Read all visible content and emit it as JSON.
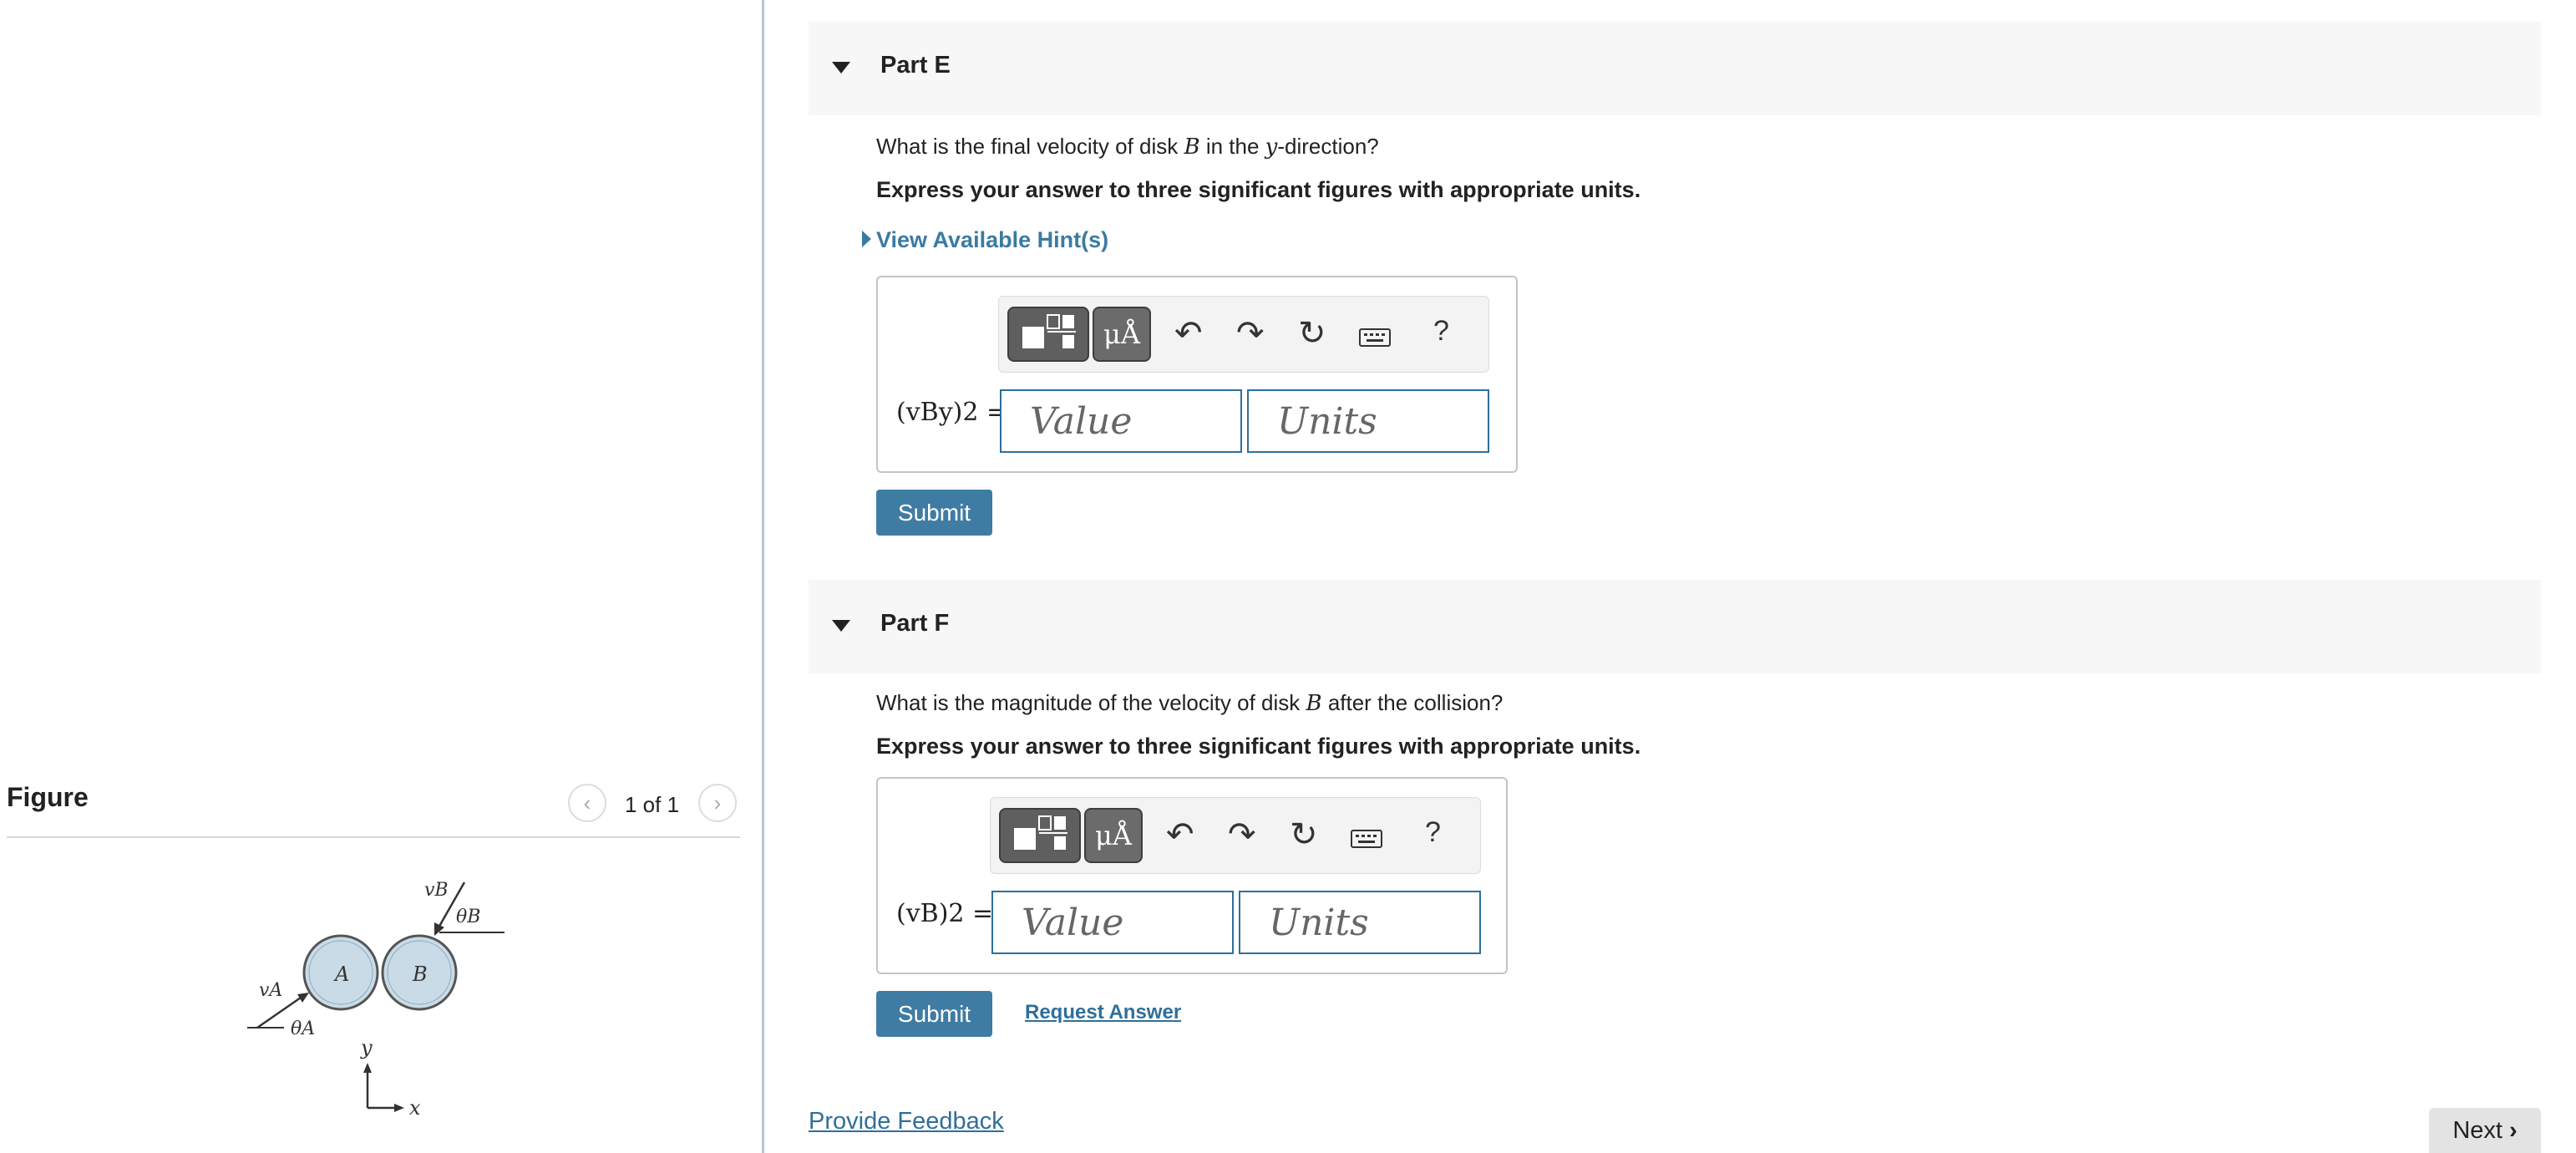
{
  "figure": {
    "title": "Figure",
    "pager": "1 of 1",
    "prev_icon": "chevron-left-icon",
    "next_icon": "chevron-right-icon",
    "labels": {
      "vB": "vB",
      "thetaB": "θB",
      "vA": "vA",
      "thetaA": "θA",
      "diskA": "A",
      "diskB": "B",
      "y": "y",
      "x": "x"
    }
  },
  "partE": {
    "title": "Part E",
    "question_pre": "What is the final velocity of disk ",
    "question_var": "B",
    "question_mid": " in the ",
    "question_var2": "y",
    "question_post": "-direction?",
    "instruction": "Express your answer to three significant figures with appropriate units.",
    "hint": "View Available Hint(s)",
    "eq_label": "(vBy)2 =",
    "value_placeholder": "Value",
    "units_placeholder": "Units",
    "submit": "Submit"
  },
  "partF": {
    "title": "Part F",
    "question_pre": "What is the magnitude of the velocity of disk ",
    "question_var": "B",
    "question_post": " after the collision?",
    "instruction": "Express your answer to three significant figures with appropriate units.",
    "eq_label": "(vB)2 =",
    "value_placeholder": "Value",
    "units_placeholder": "Units",
    "submit": "Submit",
    "request_answer": "Request Answer"
  },
  "toolbar": {
    "mu_label": "μÅ",
    "help_label": "?",
    "icons": [
      "templates-icon",
      "units-icon",
      "undo-icon",
      "redo-icon",
      "reset-icon",
      "keyboard-icon",
      "help-icon"
    ]
  },
  "footer": {
    "feedback": "Provide Feedback",
    "next": "Next"
  },
  "colors": {
    "accent": "#3f7ca3",
    "link": "#2f6f9a",
    "disk_fill": "#c9dbe6"
  }
}
